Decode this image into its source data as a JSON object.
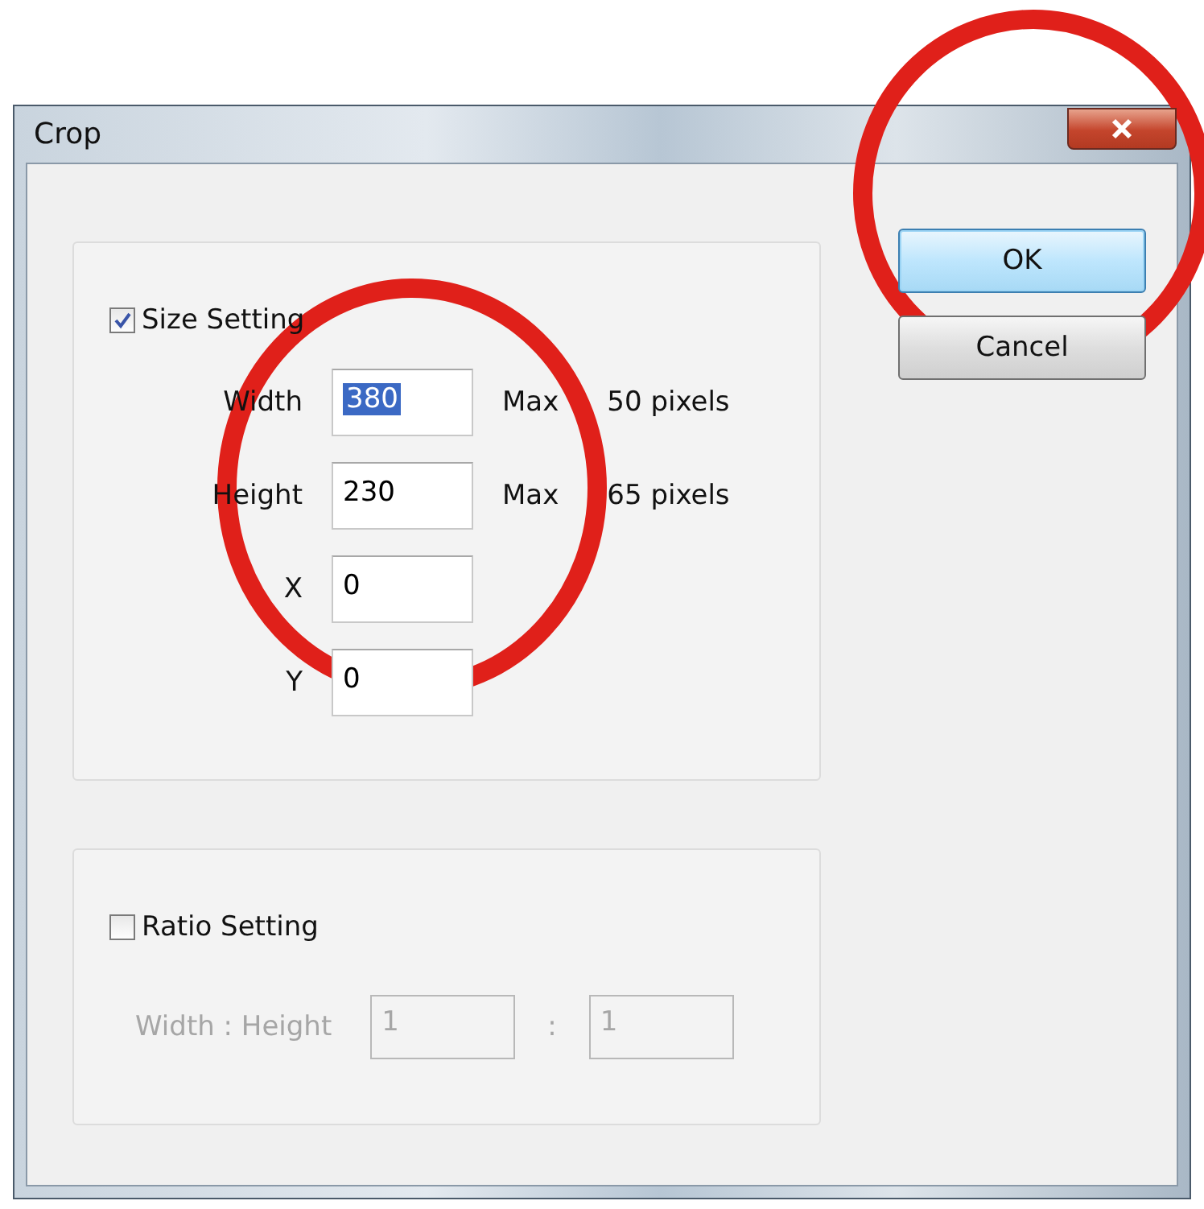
{
  "window": {
    "title": "Crop"
  },
  "size_setting": {
    "label": "Size Setting",
    "checked": true,
    "fields": [
      {
        "label": "Width",
        "value": "380",
        "text_selected": true,
        "max_prefix": "Max",
        "max_suffix": "50 pixels"
      },
      {
        "label": "Height",
        "value": "230",
        "text_selected": false,
        "max_prefix": "Max",
        "max_suffix": "65 pixels"
      },
      {
        "label": "X",
        "value": "0",
        "text_selected": false
      },
      {
        "label": "Y",
        "value": "0",
        "text_selected": false
      }
    ]
  },
  "ratio_setting": {
    "label": "Ratio Setting",
    "checked": false,
    "disabled": true,
    "field_label": "Width : Height",
    "width_value": "1",
    "separator": ":",
    "height_value": "1"
  },
  "buttons": [
    {
      "label": "OK",
      "default": true
    },
    {
      "label": "Cancel",
      "default": false
    }
  ]
}
